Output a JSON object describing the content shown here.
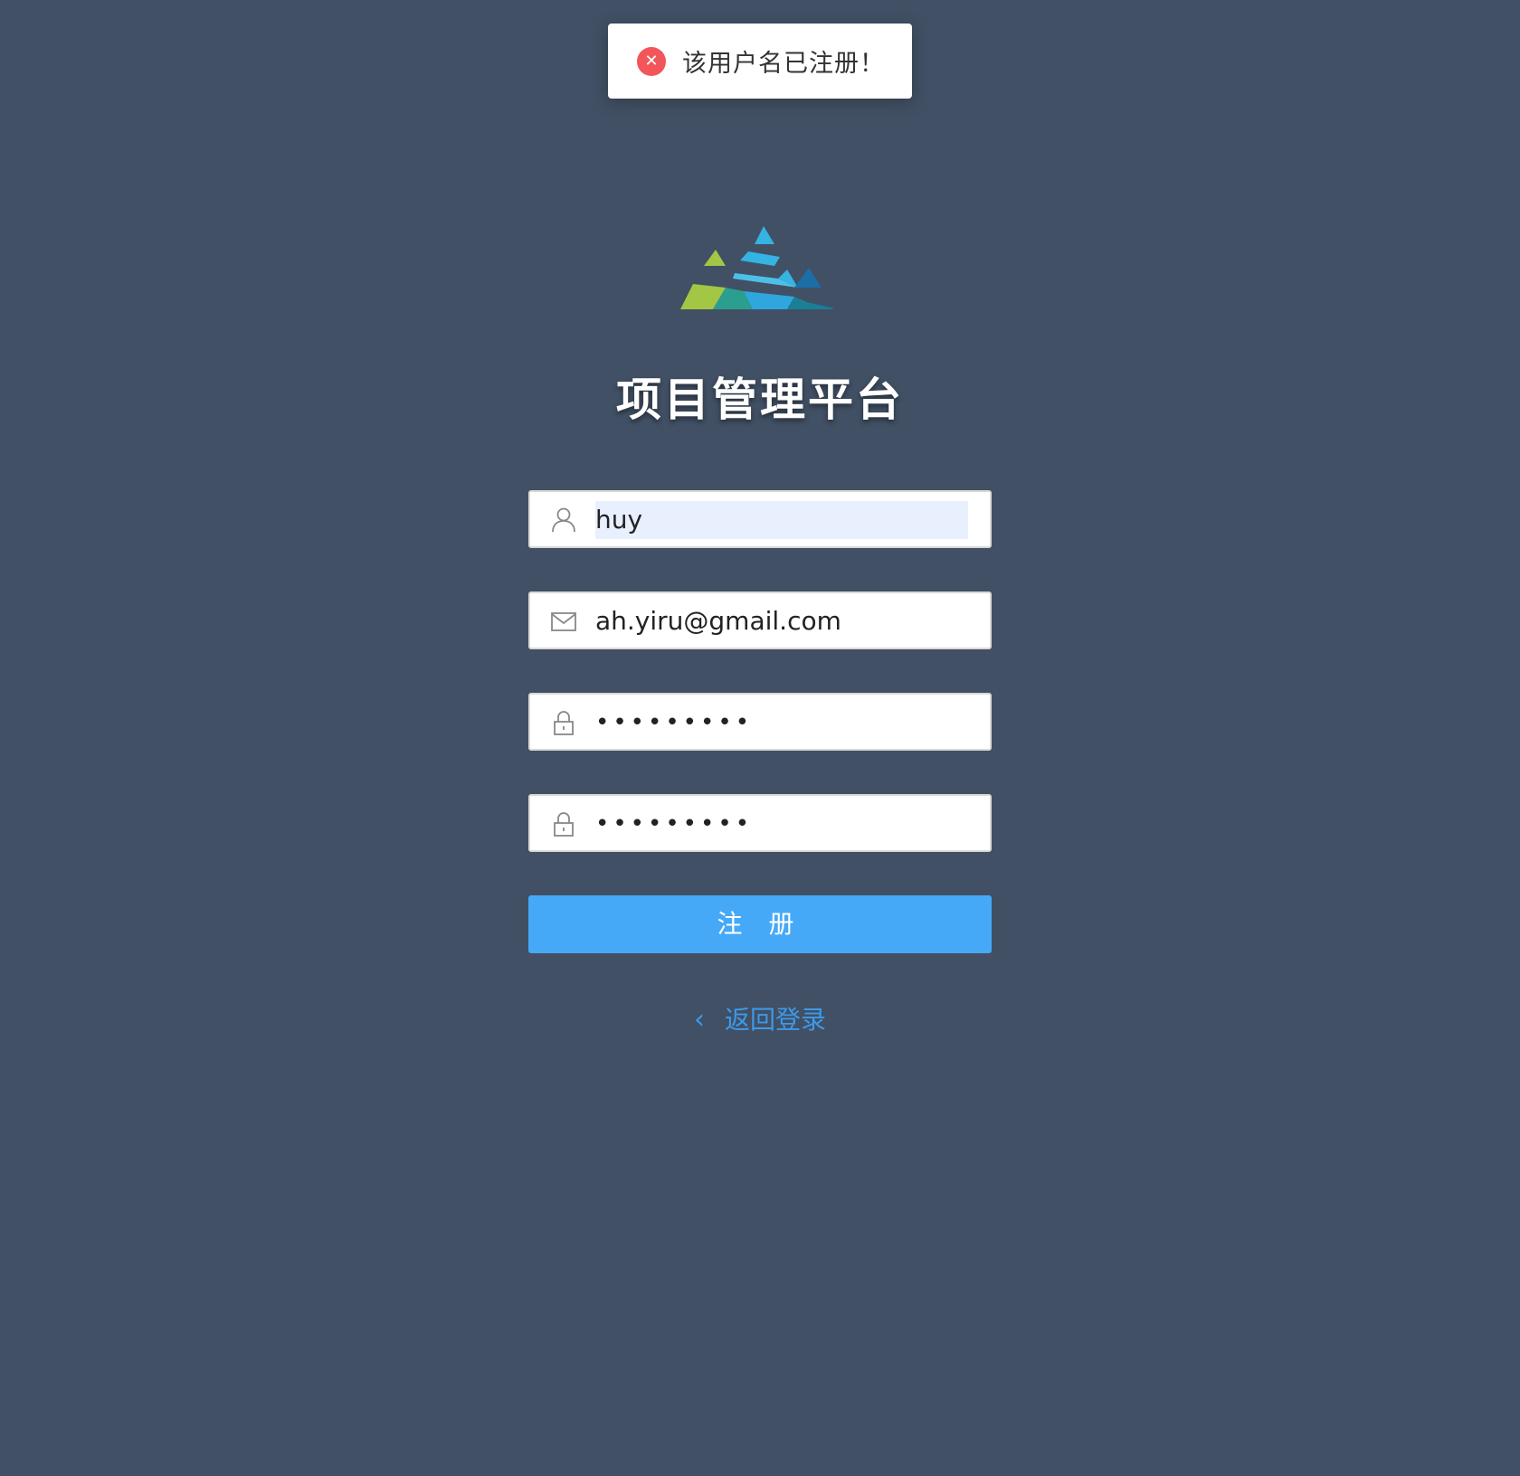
{
  "toast": {
    "icon": "error-circle-icon",
    "message": "该用户名已注册！",
    "icon_color": "#f2555a"
  },
  "logo": {
    "colors": [
      "#a3c644",
      "#35b3e3",
      "#1a8bb8",
      "#2b9f8f",
      "#1b6ea6"
    ]
  },
  "title": "项目管理平台",
  "form": {
    "username": {
      "icon": "user-icon",
      "value": "huy"
    },
    "email": {
      "icon": "mail-icon",
      "value": "ah.yiru@gmail.com"
    },
    "password": {
      "icon": "lock-icon",
      "value": "•••••••••"
    },
    "confirm_password": {
      "icon": "lock-icon",
      "value": "•••••••••"
    },
    "submit_label": "注 册"
  },
  "back_link": {
    "icon": "chevron-left-icon",
    "label": "返回登录"
  },
  "colors": {
    "background": "#415064",
    "primary": "#46a9f8",
    "link": "#3d99ea"
  }
}
